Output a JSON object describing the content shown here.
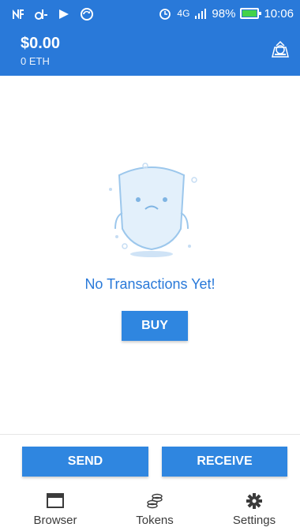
{
  "status_bar": {
    "network": "4G",
    "battery": "98%",
    "battery_level": 0.98,
    "time": "10:06"
  },
  "wallet": {
    "balance": "$0.00",
    "balance_sub": "0 ETH"
  },
  "empty_state": {
    "message": "No Transactions Yet!",
    "buy_label": "BUY"
  },
  "actions": {
    "send_label": "SEND",
    "receive_label": "RECEIVE"
  },
  "tabs": [
    {
      "label": "Browser",
      "icon": "browser-icon"
    },
    {
      "label": "Tokens",
      "icon": "coins-icon"
    },
    {
      "label": "Settings",
      "icon": "gear-icon"
    }
  ],
  "colors": {
    "primary": "#2979d9",
    "button": "#2f86e0"
  }
}
